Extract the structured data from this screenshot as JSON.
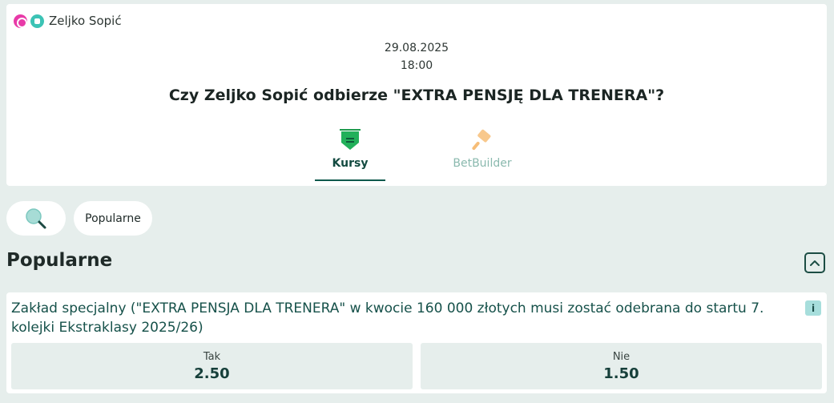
{
  "event": {
    "participant": "Zeljko Sopić",
    "participant_icons": [
      "sport-badge-icon",
      "category-badge-icon"
    ],
    "date": "29.08.2025",
    "time": "18:00",
    "title": "Czy Zeljko Sopić odbierze \"EXTRA PENSJĘ DLA TRENERA\"?",
    "tabs": [
      {
        "label": "Kursy",
        "icon": "odds-tag-icon",
        "active": true
      },
      {
        "label": "BetBuilder",
        "icon": "hammer-icon",
        "active": false
      }
    ]
  },
  "filters": {
    "search_icon": "search-icon",
    "chips": [
      "Popularne"
    ]
  },
  "section": {
    "heading": "Popularne",
    "collapse_icon": "chevron-up-icon"
  },
  "market": {
    "description": "Zakład specjalny (\"EXTRA PENSJA DLA TRENERA\" w kwocie 160 000 złotych musi zostać odebrana do startu 7. kolejki Ekstraklasy 2025/26)",
    "info_label": "i",
    "outcomes": [
      {
        "label": "Tak",
        "odds": "2.50"
      },
      {
        "label": "Nie",
        "odds": "1.50"
      }
    ]
  },
  "colors": {
    "accent": "#0f5a4d",
    "background": "#e6eeec",
    "active_tab_icon": "#22b05a",
    "inactive_tab_icon": "#f8c88c"
  }
}
